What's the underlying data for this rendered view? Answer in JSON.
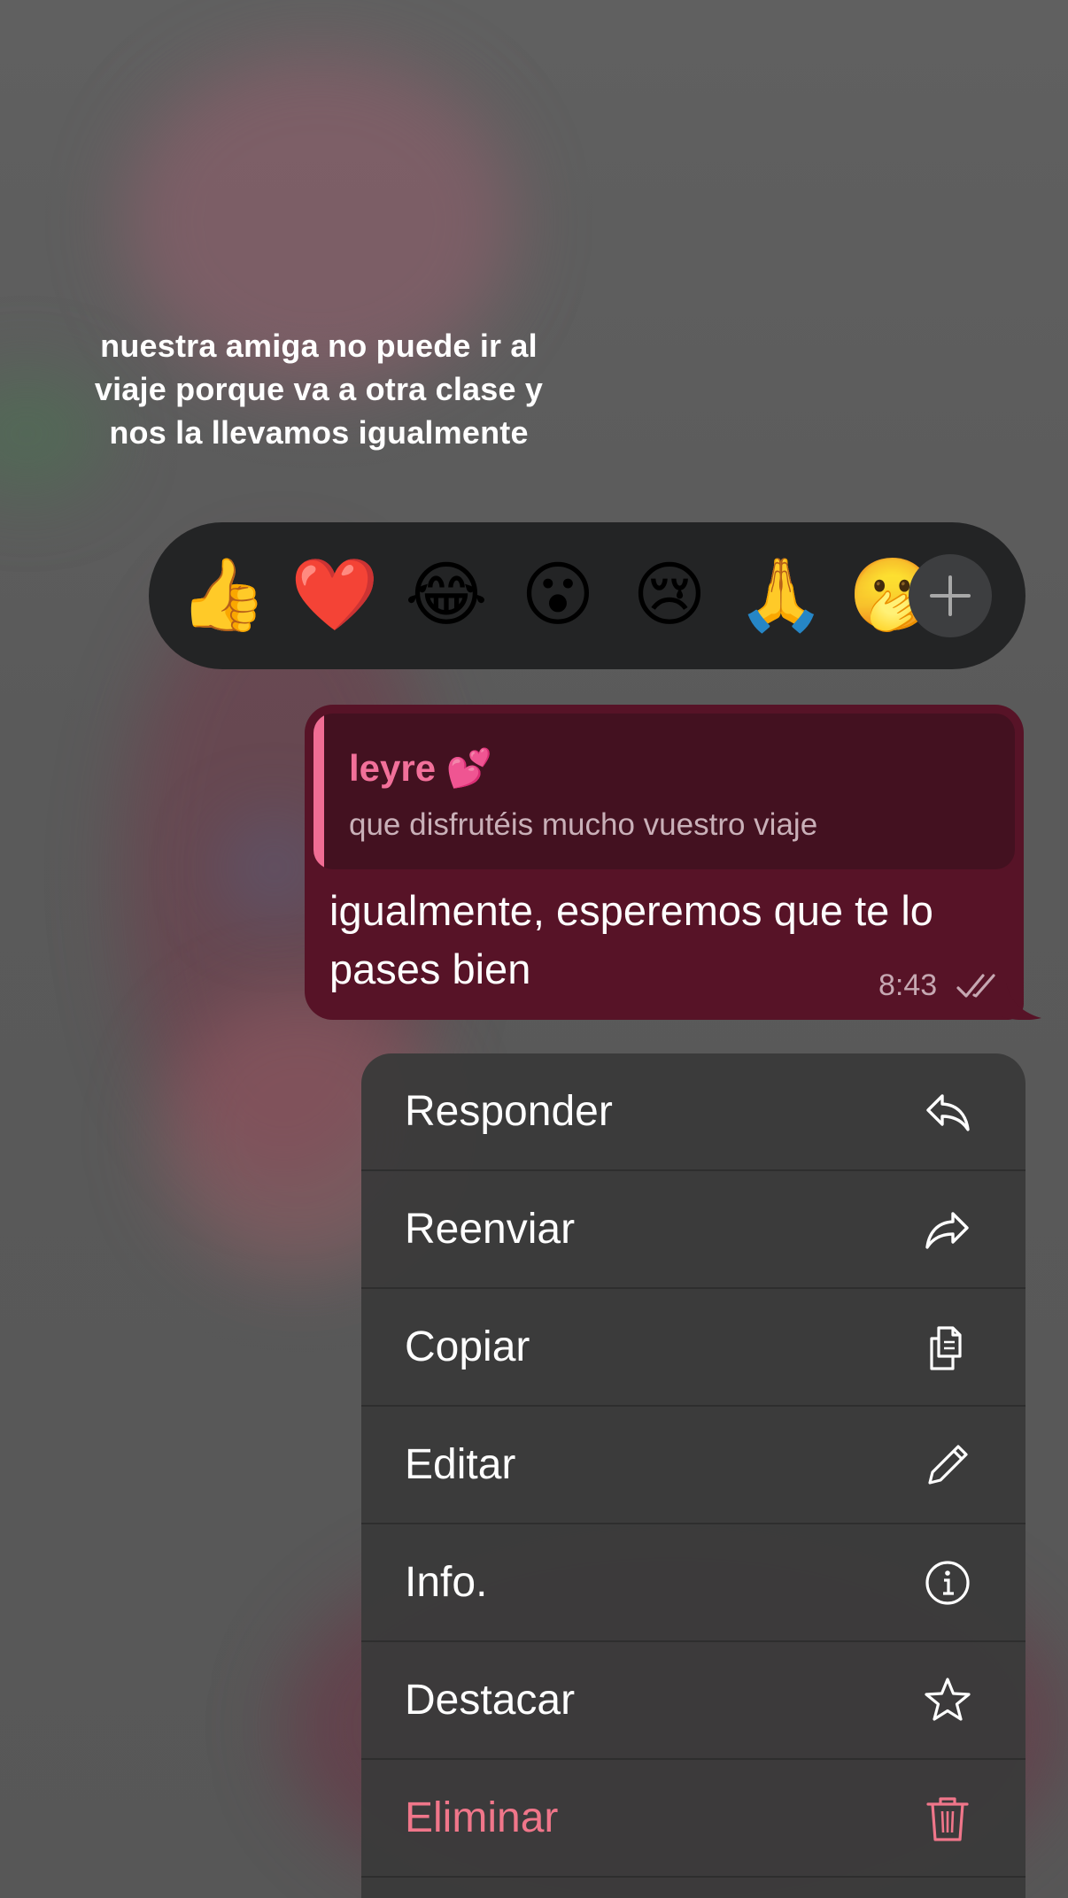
{
  "caption": {
    "line1": "nuestra amiga no puede ir al",
    "line2": "viaje porque va a otra clase y",
    "line3": "nos la llevamos igualmente"
  },
  "reactions": {
    "emojis": [
      "👍",
      "❤️",
      "😂",
      "😮",
      "😢",
      "🙏",
      "🫢"
    ],
    "more_icon": "plus-icon"
  },
  "message": {
    "reply": {
      "name": "leyre 💕",
      "text": "que disfrutéis mucho vuestro viaje"
    },
    "text": "igualmente, esperemos que te lo pases bien",
    "time": "8:43",
    "status_icon": "double-check-icon"
  },
  "menu": {
    "items": [
      {
        "label": "Responder",
        "icon": "reply-icon"
      },
      {
        "label": "Reenviar",
        "icon": "forward-icon"
      },
      {
        "label": "Copiar",
        "icon": "copy-icon"
      },
      {
        "label": "Editar",
        "icon": "pencil-icon"
      },
      {
        "label": "Info.",
        "icon": "info-icon"
      },
      {
        "label": "Destacar",
        "icon": "star-icon"
      },
      {
        "label": "Eliminar",
        "icon": "trash-icon"
      }
    ]
  },
  "colors": {
    "bubble": "#571327",
    "reply_accent": "#f06d94",
    "danger": "#f0768a"
  }
}
